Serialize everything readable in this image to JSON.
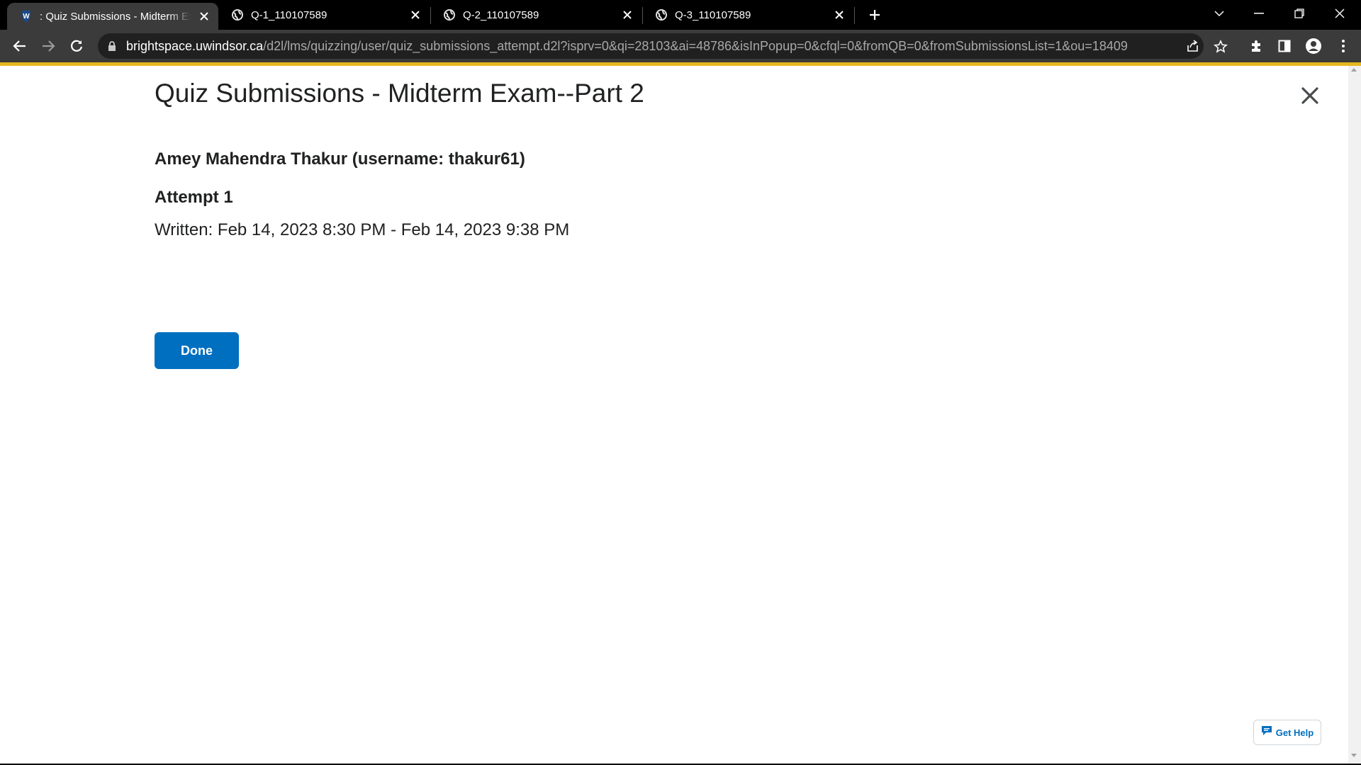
{
  "browser": {
    "tabs": [
      {
        "title": ": Quiz Submissions - Midterm Exam--Part 2",
        "favicon": "uwindsor-logo-icon",
        "active": true
      },
      {
        "title": "Q-1_110107589",
        "favicon": "globe-icon",
        "active": false
      },
      {
        "title": "Q-2_110107589",
        "favicon": "globe-icon",
        "active": false
      },
      {
        "title": "Q-3_110107589",
        "favicon": "globe-icon",
        "active": false
      }
    ],
    "url_host": "brightspace.uwindsor.ca",
    "url_path": "/d2l/lms/quizzing/user/quiz_submissions_attempt.d2l?isprv=0&qi=28103&ai=48786&isInPopup=0&cfql=0&fromQB=0&fromSubmissionsList=1&ou=18409",
    "accent_color": "#e8b71f"
  },
  "page": {
    "title": "Quiz Submissions - Midterm Exam--Part 2",
    "student": "Amey Mahendra Thakur (username: thakur61)",
    "attempt": "Attempt 1",
    "written": "Written: Feb 14, 2023 8:30 PM - Feb 14, 2023 9:38 PM",
    "done_label": "Done",
    "get_help_label": "Get Help",
    "primary_color": "#006fbf"
  }
}
